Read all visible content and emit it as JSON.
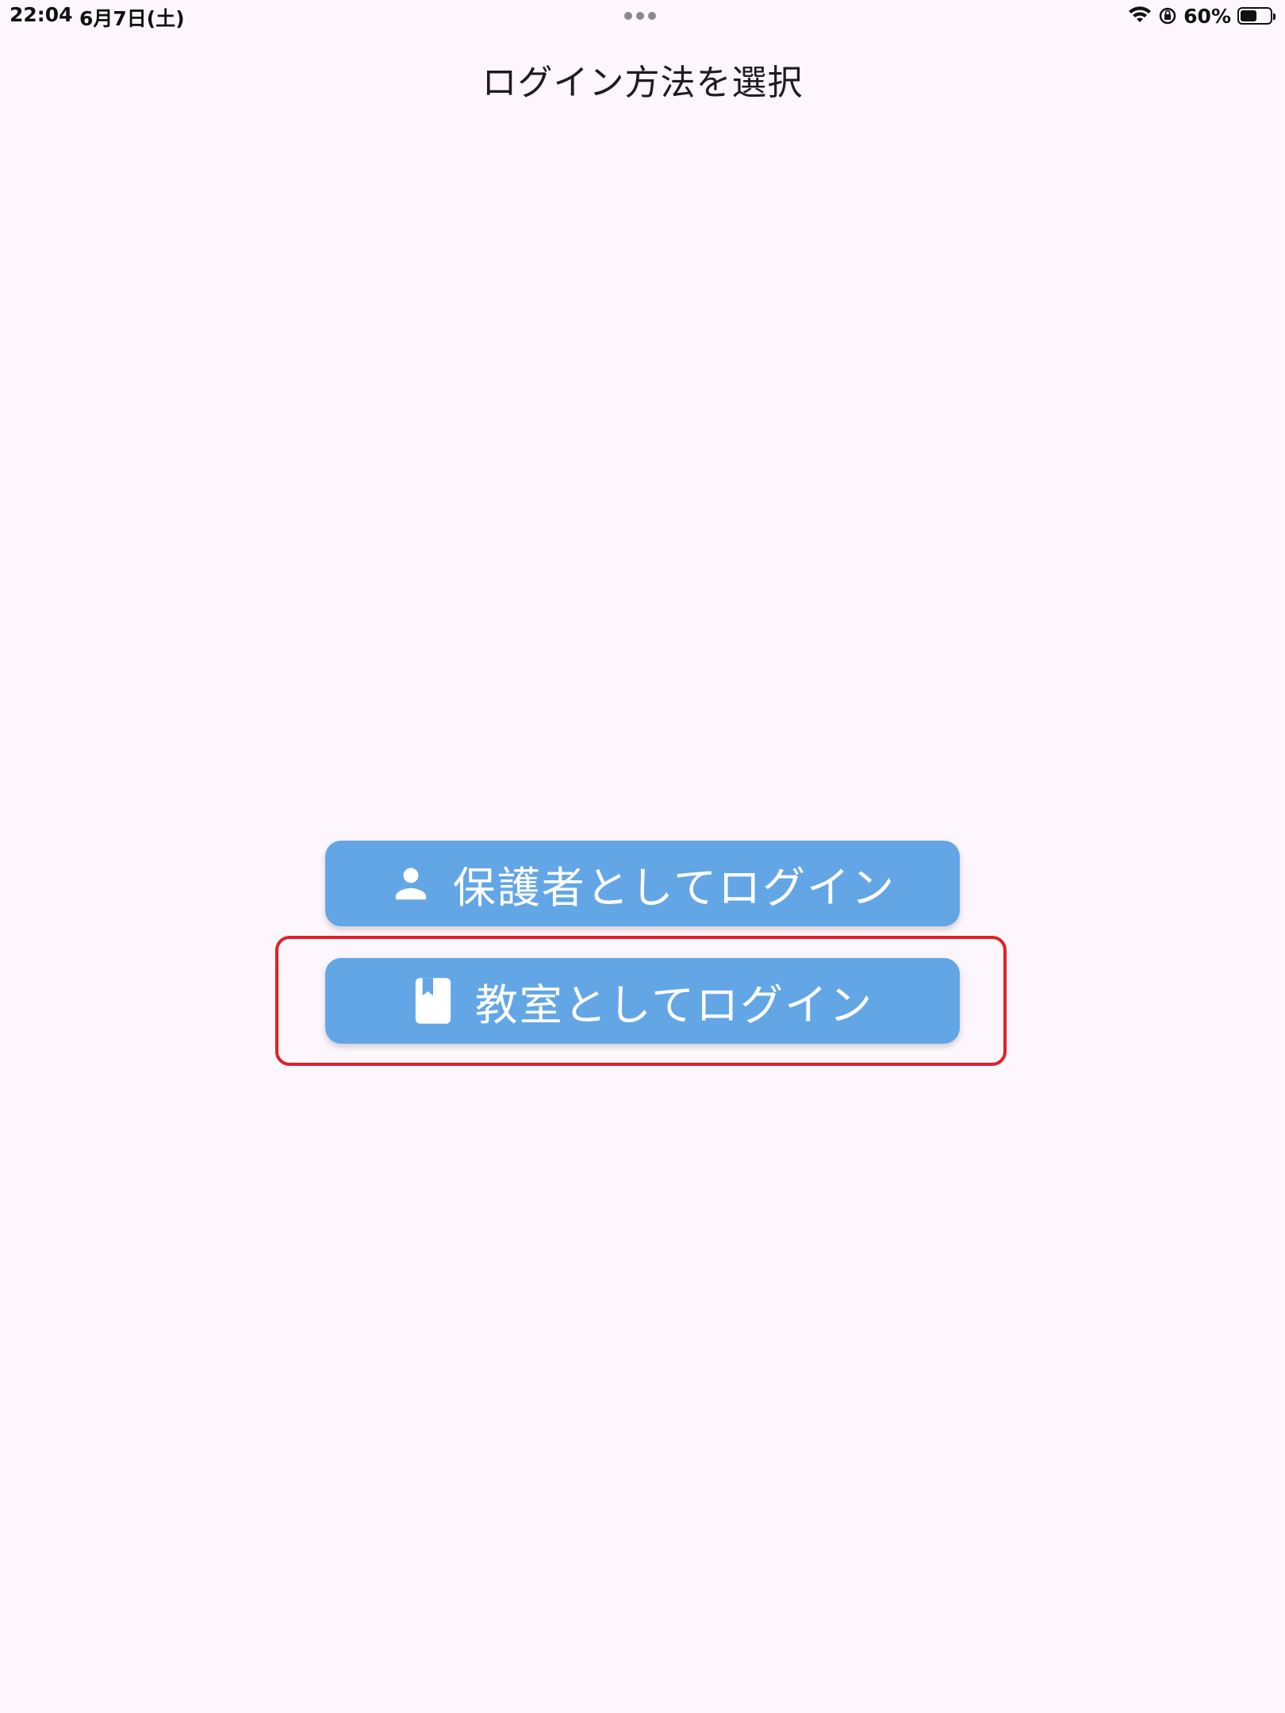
{
  "status_bar": {
    "time": "22:04",
    "date": "6月7日(土)",
    "battery_percent": "60%",
    "battery_level": 0.6,
    "icons": [
      "wifi-icon",
      "lock-rotation-icon",
      "battery-icon"
    ]
  },
  "header": {
    "title": "ログイン方法を選択"
  },
  "buttons": {
    "guardian": {
      "label": "保護者としてログイン",
      "icon": "person-icon"
    },
    "classroom": {
      "label": "教室としてログイン",
      "icon": "book-icon"
    }
  },
  "colors": {
    "background": "#fdf7fd",
    "button": "#63a6e6",
    "button_text": "#ffffff",
    "highlight": "#e0202b"
  }
}
